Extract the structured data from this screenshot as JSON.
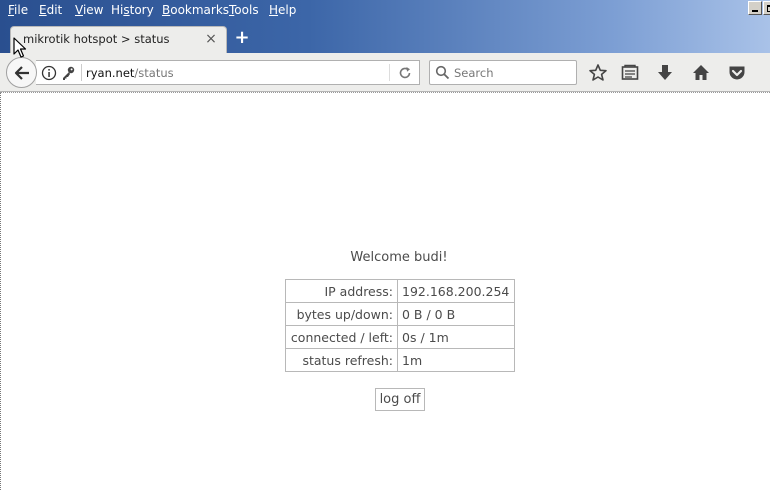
{
  "menu": {
    "file": {
      "acc": "F",
      "rest": "ile"
    },
    "edit": {
      "acc": "E",
      "rest": "dit"
    },
    "view": {
      "acc": "V",
      "rest": "iew"
    },
    "history": {
      "pre": "Hi",
      "acc": "s",
      "rest": "tory"
    },
    "bookmarks": {
      "acc": "B",
      "rest": "ookmarks"
    },
    "tools": {
      "acc": "T",
      "rest": "ools"
    },
    "help": {
      "acc": "H",
      "rest": "elp"
    }
  },
  "tab": {
    "title": "mikrotik hotspot > status",
    "close": "×"
  },
  "new_tab": "+",
  "url": {
    "host": "ryan.net",
    "path": "/status"
  },
  "search": {
    "placeholder": "Search"
  },
  "page": {
    "welcome": "Welcome budi!",
    "rows": [
      {
        "key": "IP address:",
        "value": "192.168.200.254"
      },
      {
        "key": "bytes up/down:",
        "value": "0 B / 0 B"
      },
      {
        "key": "connected / left:",
        "value": "0s / 1m"
      },
      {
        "key": "status refresh:",
        "value": "1m"
      }
    ],
    "logoff": "log off"
  },
  "colors": {
    "title_bar_start": "#2a4f8f",
    "title_bar_end": "#a9c2e8",
    "page_text": "#4b4b4b"
  },
  "icons": [
    "back-arrow-icon",
    "info-icon",
    "key-icon",
    "reload-icon",
    "search-icon",
    "star-icon",
    "reader-list-icon",
    "download-icon",
    "home-icon",
    "pocket-icon",
    "close-icon",
    "plus-icon",
    "cursor-icon",
    "minimize-icon",
    "restore-icon"
  ]
}
